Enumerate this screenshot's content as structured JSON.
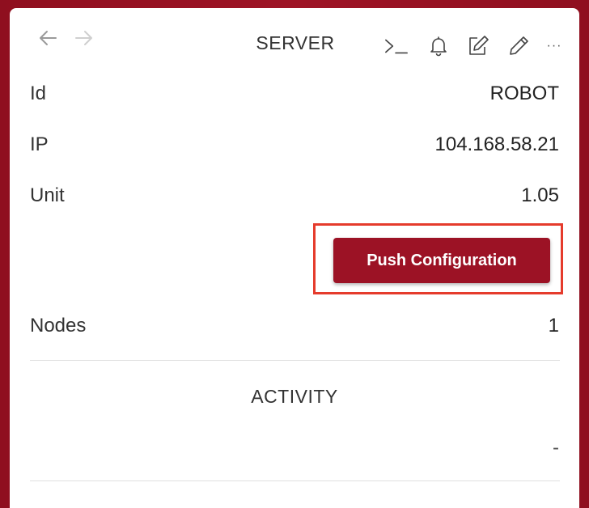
{
  "header": {
    "title": "SERVER",
    "back_icon": "arrow-left-icon",
    "forward_icon": "arrow-right-icon",
    "tools": [
      "terminal-icon",
      "bell-icon",
      "edit-icon",
      "pencil-icon",
      "more-icon"
    ],
    "more_label": "···"
  },
  "fields": {
    "id": {
      "label": "Id",
      "value": "ROBOT"
    },
    "ip": {
      "label": "IP",
      "value": "104.168.58.21"
    },
    "unit": {
      "label": "Unit",
      "value": "1.05"
    },
    "nodes": {
      "label": "Nodes",
      "value": "1"
    }
  },
  "actions": {
    "push_label": "Push Configuration"
  },
  "activity": {
    "title": "ACTIVITY",
    "value": "-"
  },
  "colors": {
    "accent": "#9c1225",
    "highlight": "#e53b2c",
    "background": "#8f0f1f"
  }
}
